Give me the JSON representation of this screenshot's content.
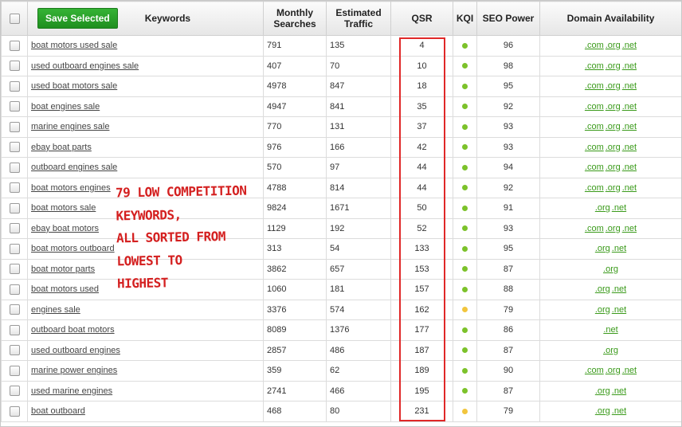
{
  "header": {
    "save_label": "Save Selected",
    "keywords": "Keywords",
    "monthly_searches_1": "Monthly",
    "monthly_searches_2": "Searches",
    "estimated_traffic_1": "Estimated",
    "estimated_traffic_2": "Traffic",
    "qsr": "QSR",
    "kqi": "KQI",
    "seo_power": "SEO Power",
    "domain_availability": "Domain Availability"
  },
  "colors": {
    "kqi_green": "#7cc22a",
    "kqi_yellow": "#f2c53d",
    "annotation_red": "#d42020",
    "qsr_box_red": "#e02828"
  },
  "annotation": {
    "line1": "79 LOW COMPETITION",
    "line2": "KEYWORDS,",
    "line3": "ALL SORTED FROM",
    "line4": "LOWEST TO",
    "line5": "HIGHEST"
  },
  "rows": [
    {
      "keyword": "boat motors used sale",
      "searches": "791",
      "traffic": "135",
      "qsr": "4",
      "kqi": "green",
      "seo": "96",
      "domains": [
        ".com",
        ".org",
        ".net"
      ]
    },
    {
      "keyword": "used outboard engines sale",
      "searches": "407",
      "traffic": "70",
      "qsr": "10",
      "kqi": "green",
      "seo": "98",
      "domains": [
        ".com",
        ".org",
        ".net"
      ]
    },
    {
      "keyword": "used boat motors sale",
      "searches": "4978",
      "traffic": "847",
      "qsr": "18",
      "kqi": "green",
      "seo": "95",
      "domains": [
        ".com",
        ".org",
        ".net"
      ]
    },
    {
      "keyword": "boat engines sale",
      "searches": "4947",
      "traffic": "841",
      "qsr": "35",
      "kqi": "green",
      "seo": "92",
      "domains": [
        ".com",
        ".org",
        ".net"
      ]
    },
    {
      "keyword": "marine engines sale",
      "searches": "770",
      "traffic": "131",
      "qsr": "37",
      "kqi": "green",
      "seo": "93",
      "domains": [
        ".com",
        ".org",
        ".net"
      ]
    },
    {
      "keyword": "ebay boat parts",
      "searches": "976",
      "traffic": "166",
      "qsr": "42",
      "kqi": "green",
      "seo": "93",
      "domains": [
        ".com",
        ".org",
        ".net"
      ]
    },
    {
      "keyword": "outboard engines sale",
      "searches": "570",
      "traffic": "97",
      "qsr": "44",
      "kqi": "green",
      "seo": "94",
      "domains": [
        ".com",
        ".org",
        ".net"
      ]
    },
    {
      "keyword": "boat motors engines",
      "searches": "4788",
      "traffic": "814",
      "qsr": "44",
      "kqi": "green",
      "seo": "92",
      "domains": [
        ".com",
        ".org",
        ".net"
      ]
    },
    {
      "keyword": "boat motors sale",
      "searches": "9824",
      "traffic": "1671",
      "qsr": "50",
      "kqi": "green",
      "seo": "91",
      "domains": [
        ".org",
        ".net"
      ]
    },
    {
      "keyword": "ebay boat motors",
      "searches": "1129",
      "traffic": "192",
      "qsr": "52",
      "kqi": "green",
      "seo": "93",
      "domains": [
        ".com",
        ".org",
        ".net"
      ]
    },
    {
      "keyword": "boat motors outboard",
      "searches": "313",
      "traffic": "54",
      "qsr": "133",
      "kqi": "green",
      "seo": "95",
      "domains": [
        ".org",
        ".net"
      ]
    },
    {
      "keyword": "boat motor parts",
      "searches": "3862",
      "traffic": "657",
      "qsr": "153",
      "kqi": "green",
      "seo": "87",
      "domains": [
        ".org"
      ]
    },
    {
      "keyword": "boat motors used",
      "searches": "1060",
      "traffic": "181",
      "qsr": "157",
      "kqi": "green",
      "seo": "88",
      "domains": [
        ".org",
        ".net"
      ]
    },
    {
      "keyword": "engines sale",
      "searches": "3376",
      "traffic": "574",
      "qsr": "162",
      "kqi": "yellow",
      "seo": "79",
      "domains": [
        ".org",
        ".net"
      ]
    },
    {
      "keyword": "outboard boat motors",
      "searches": "8089",
      "traffic": "1376",
      "qsr": "177",
      "kqi": "green",
      "seo": "86",
      "domains": [
        ".net"
      ]
    },
    {
      "keyword": "used outboard engines",
      "searches": "2857",
      "traffic": "486",
      "qsr": "187",
      "kqi": "green",
      "seo": "87",
      "domains": [
        ".org"
      ]
    },
    {
      "keyword": "marine power engines",
      "searches": "359",
      "traffic": "62",
      "qsr": "189",
      "kqi": "green",
      "seo": "90",
      "domains": [
        ".com",
        ".org",
        ".net"
      ]
    },
    {
      "keyword": "used marine engines",
      "searches": "2741",
      "traffic": "466",
      "qsr": "195",
      "kqi": "green",
      "seo": "87",
      "domains": [
        ".org",
        ".net"
      ]
    },
    {
      "keyword": "boat outboard",
      "searches": "468",
      "traffic": "80",
      "qsr": "231",
      "kqi": "yellow",
      "seo": "79",
      "domains": [
        ".org",
        ".net"
      ]
    }
  ]
}
